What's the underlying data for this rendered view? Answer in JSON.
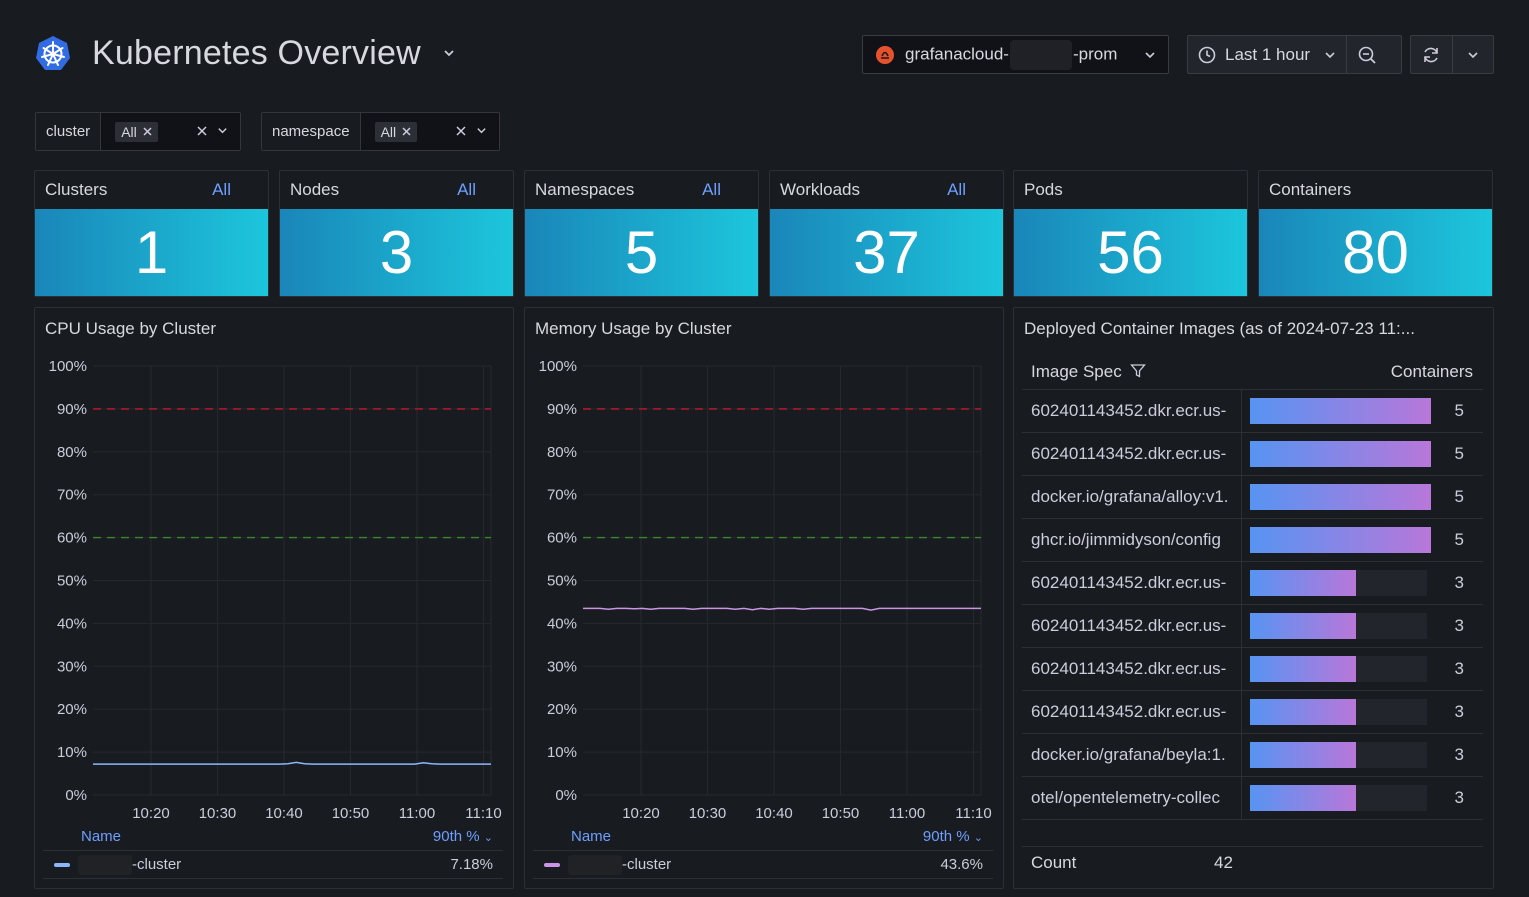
{
  "header": {
    "title": "Kubernetes Overview",
    "datasource": {
      "prefix": "grafanacloud-",
      "suffix": "-prom"
    },
    "time_range": "Last 1 hour"
  },
  "variables": [
    {
      "name": "cluster",
      "value": "All"
    },
    {
      "name": "namespace",
      "value": "All"
    }
  ],
  "stats": [
    {
      "label": "Clusters",
      "link": "All",
      "value": "1"
    },
    {
      "label": "Nodes",
      "link": "All",
      "value": "3"
    },
    {
      "label": "Namespaces",
      "link": "All",
      "value": "5"
    },
    {
      "label": "Workloads",
      "link": "All",
      "value": "37"
    },
    {
      "label": "Pods",
      "link": "",
      "value": "56"
    },
    {
      "label": "Containers",
      "link": "",
      "value": "80"
    }
  ],
  "cpu_panel": {
    "title": "CPU Usage by Cluster",
    "legend_name": "Name",
    "legend_calc": "90th %",
    "series_suffix": "-cluster",
    "series_value": "7.18%"
  },
  "mem_panel": {
    "title": "Memory Usage by Cluster",
    "legend_name": "Name",
    "legend_calc": "90th %",
    "series_suffix": "-cluster",
    "series_value": "43.6%"
  },
  "images_panel": {
    "title": "Deployed Container Images (as of 2024-07-23 11:...",
    "col_spec": "Image Spec",
    "col_count": "Containers",
    "rows": [
      {
        "spec": "602401143452.dkr.ecr.us-",
        "count": 5
      },
      {
        "spec": "602401143452.dkr.ecr.us-",
        "count": 5
      },
      {
        "spec": "docker.io/grafana/alloy:v1.",
        "count": 5
      },
      {
        "spec": "ghcr.io/jimmidyson/config",
        "count": 5
      },
      {
        "spec": "602401143452.dkr.ecr.us-",
        "count": 3
      },
      {
        "spec": "602401143452.dkr.ecr.us-",
        "count": 3
      },
      {
        "spec": "602401143452.dkr.ecr.us-",
        "count": 3
      },
      {
        "spec": "602401143452.dkr.ecr.us-",
        "count": 3
      },
      {
        "spec": "docker.io/grafana/beyla:1.",
        "count": 3
      },
      {
        "spec": "otel/opentelemetry-collec",
        "count": 3
      }
    ],
    "bar_max": 5,
    "footer_label": "Count",
    "footer_value": "42"
  },
  "chart_data": [
    {
      "type": "line",
      "title": "CPU Usage by Cluster",
      "y_ticks": [
        "100%",
        "90%",
        "80%",
        "70%",
        "60%",
        "50%",
        "40%",
        "30%",
        "20%",
        "10%",
        "0%"
      ],
      "x_ticks": [
        "10:20",
        "10:30",
        "10:40",
        "10:50",
        "11:00",
        "11:10"
      ],
      "ylim": [
        0,
        100
      ],
      "thresholds": [
        {
          "value": 90,
          "color": "#c4162a"
        },
        {
          "value": 60,
          "color": "#37872d"
        }
      ],
      "series": [
        {
          "color": "#8ab8ff",
          "values": [
            7.2,
            7.2,
            7.2,
            7.2,
            7.2,
            7.2,
            7.2,
            7.2,
            7.2,
            7.2,
            7.2,
            7.2,
            7.2,
            7.2,
            7.2,
            7.2,
            7.2,
            7.2,
            7.2,
            7.2,
            7.2,
            7.2,
            7.2,
            7.3,
            7.6,
            7.3,
            7.2,
            7.2,
            7.2,
            7.2,
            7.2,
            7.2,
            7.2,
            7.2,
            7.2,
            7.2,
            7.2,
            7.2,
            7.2,
            7.5,
            7.3,
            7.2,
            7.2,
            7.2,
            7.2,
            7.2,
            7.2,
            7.2
          ]
        }
      ]
    },
    {
      "type": "line",
      "title": "Memory Usage by Cluster",
      "y_ticks": [
        "100%",
        "90%",
        "80%",
        "70%",
        "60%",
        "50%",
        "40%",
        "30%",
        "20%",
        "10%",
        "0%"
      ],
      "x_ticks": [
        "10:20",
        "10:30",
        "10:40",
        "10:50",
        "11:00",
        "11:10"
      ],
      "ylim": [
        0,
        100
      ],
      "thresholds": [
        {
          "value": 90,
          "color": "#c4162a"
        },
        {
          "value": 60,
          "color": "#37872d"
        }
      ],
      "series": [
        {
          "color": "#ca95e5",
          "values": [
            43.5,
            43.5,
            43.5,
            43.3,
            43.5,
            43.5,
            43.4,
            43.5,
            43.3,
            43.5,
            43.5,
            43.5,
            43.5,
            43.3,
            43.5,
            43.5,
            43.5,
            43.5,
            43.3,
            43.5,
            43.2,
            43.5,
            43.3,
            43.5,
            43.5,
            43.5,
            43.3,
            43.5,
            43.5,
            43.5,
            43.5,
            43.5,
            43.5,
            43.5,
            43.1,
            43.5,
            43.5,
            43.5,
            43.5,
            43.5,
            43.5,
            43.5,
            43.5,
            43.5,
            43.5,
            43.5,
            43.5,
            43.5
          ]
        }
      ]
    }
  ]
}
